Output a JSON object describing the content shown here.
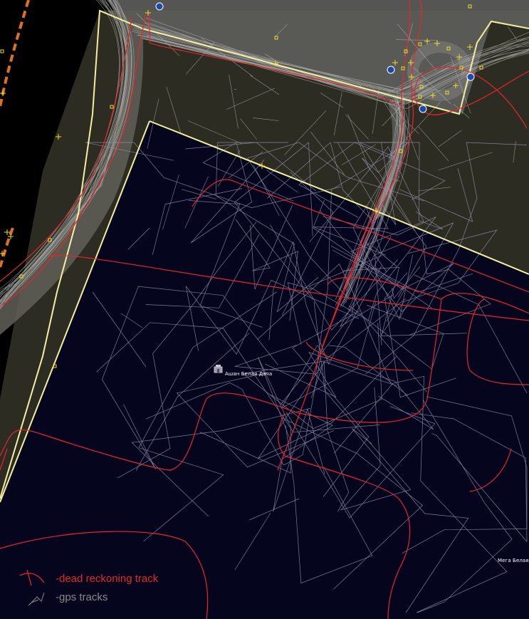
{
  "map": {
    "poi_labels": {
      "store": "Ашан Белая Дача",
      "mega": "Мега Белая"
    },
    "colors": {
      "dark_area": "#05051e",
      "land": "#2c2c22",
      "road": "#6a6a6a",
      "boundary": "#f4f0a0",
      "dead_reckoning": "#e8262a",
      "gps": "#c8c8c8",
      "gps_in_lot": "#9a9ab8"
    }
  },
  "legend": {
    "dead_reckoning_label": "-dead reckoning track",
    "gps_label": "-gps tracks"
  }
}
